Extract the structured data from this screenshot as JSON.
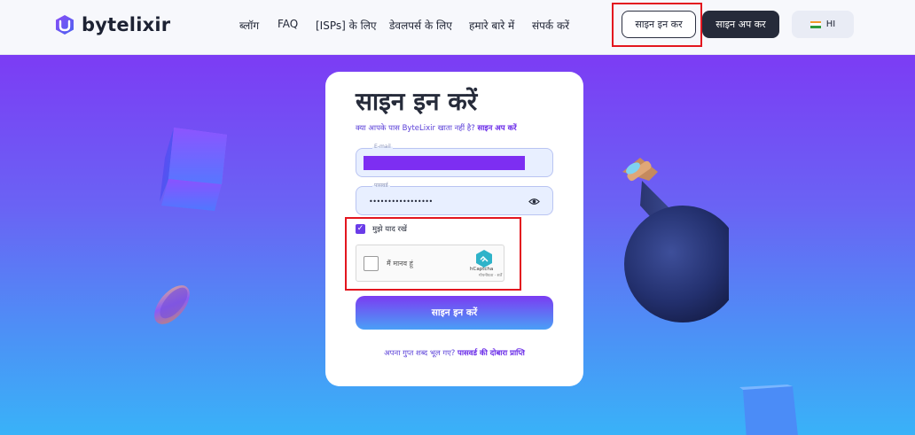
{
  "brand": {
    "name": "bytelixir"
  },
  "nav": {
    "items": [
      {
        "label": "ब्लॉग"
      },
      {
        "label": "FAQ"
      },
      {
        "label": "[ISPs] के लिए"
      },
      {
        "label": "डेवलपर्स के लिए"
      },
      {
        "label": "हमारे बारे में"
      },
      {
        "label": "संपर्क करें"
      }
    ],
    "signin_label": "साइन इन कर",
    "signup_label": "साइन अप कर",
    "lang_label": "HI"
  },
  "form": {
    "title": "साइन इन करें",
    "no_account_text": "क्या आपके पास ByteLixir खाता नहीं है?",
    "signup_link": "साइन अप करें",
    "email_label": "E-mail",
    "password_label": "पासवर्ड",
    "password_value": "•••••••••••••••••",
    "remember_label": "मुझे याद रखें",
    "remember_checked": true,
    "captcha": {
      "label": "मैं मानव हूं",
      "brand": "hCaptcha",
      "terms": "गोपनीयता · शर्तें"
    },
    "submit_label": "साइन इन करें",
    "forgot_text": "अपना गुप्त शब्द भूल गए?",
    "forgot_link": "पासवर्ड की दोबारा प्राप्ति"
  },
  "colors": {
    "accent": "#6a2be8",
    "header_bg": "#f7f8fc",
    "hero_top": "#7c3cf4",
    "hero_bottom": "#39b2f8",
    "highlight": "#e3161f",
    "dark_button": "#262b3a"
  }
}
